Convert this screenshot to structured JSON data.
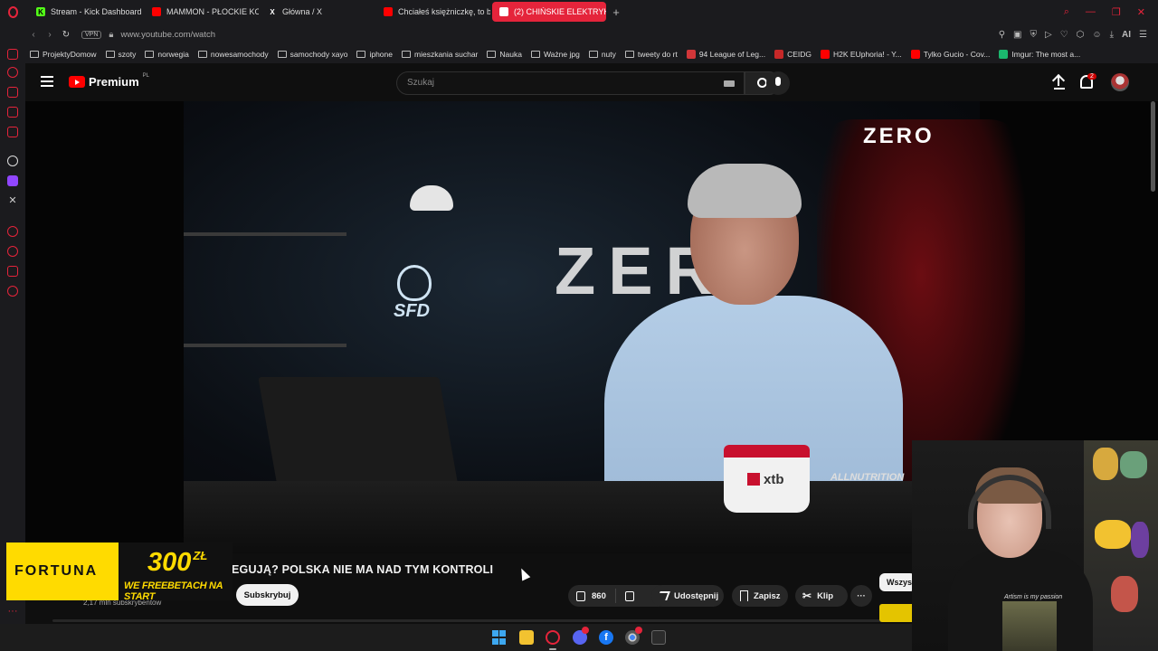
{
  "browser": {
    "tabs": [
      {
        "label": "Stream - Kick Dashboard",
        "color": "#53fc18",
        "glyph": "K"
      },
      {
        "label": "MAMMON - PŁOCKIE KOL",
        "color": "#ff0000",
        "glyph": "▶"
      },
      {
        "label": "Główna / X",
        "color": "#000000",
        "glyph": "X"
      },
      {
        "label": "Chciałeś księżniczkę, to b",
        "color": "#ff0000",
        "glyph": "▶"
      },
      {
        "label": "(2) CHIŃSKIE ELEKTRYKI",
        "color": "#ff0000",
        "glyph": "▶"
      }
    ],
    "url": "www.youtube.com/watch",
    "vpn_label": "VPN",
    "ai_label": "AI",
    "bookmarks": [
      {
        "label": "ProjektyDomow",
        "type": "folder"
      },
      {
        "label": "szoty",
        "type": "folder"
      },
      {
        "label": "norwegia",
        "type": "folder"
      },
      {
        "label": "nowesamochody",
        "type": "folder"
      },
      {
        "label": "samochody xayo",
        "type": "folder"
      },
      {
        "label": "iphone",
        "type": "folder"
      },
      {
        "label": "mieszkania suchar",
        "type": "folder"
      },
      {
        "label": "Nauka",
        "type": "folder"
      },
      {
        "label": "Ważne jpg",
        "type": "folder"
      },
      {
        "label": "nuty",
        "type": "folder"
      },
      {
        "label": "tweety do rt",
        "type": "folder"
      },
      {
        "label": "94 League of Leg...",
        "type": "site",
        "color": "#d13639"
      },
      {
        "label": "CEIDG",
        "type": "site",
        "color": "#c62828"
      },
      {
        "label": "H2K EUphoria! - Y...",
        "type": "site",
        "color": "#ff0000"
      },
      {
        "label": "Tylko Gucio - Cov...",
        "type": "site",
        "color": "#ff0000"
      },
      {
        "label": "Imgur: The most a...",
        "type": "site",
        "color": "#1bb76e"
      }
    ]
  },
  "youtube": {
    "logo_text": "Premium",
    "logo_region": "PL",
    "search_placeholder": "Szukaj",
    "notification_count": "2",
    "video_overlay_brand": "ZERO",
    "set_brand": "ZERO",
    "shelf_logo": "SFD",
    "mug_brand": "xtb",
    "desk_brand": "ALLNUTRITION",
    "video_title": "EGUJĄ? POLSKA NIE MA NAD TYM KONTROLI",
    "subscribers": "2,17 mln subskrybentów",
    "subscribe_label": "Subskrybuj",
    "like_count": "860",
    "share_label": "Udostępnij",
    "save_label": "Zapisz",
    "clip_label": "Klip",
    "more_label": "···",
    "chip_all": "Wszys"
  },
  "ad": {
    "brand": "FORTUNA",
    "amount": "300",
    "currency": "ZŁ",
    "tagline": "WE FREEBETACH NA START"
  },
  "webcam": {
    "hoodie_text": "Artism is my passion"
  }
}
